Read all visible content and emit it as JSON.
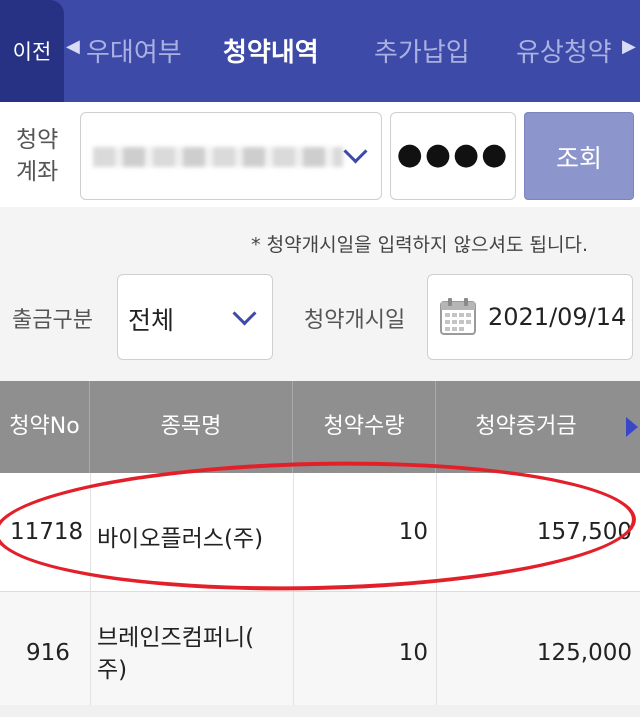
{
  "nav": {
    "back_label": "이전",
    "tabs": [
      {
        "label": "우대여부",
        "active": false
      },
      {
        "label": "청약내역",
        "active": true
      },
      {
        "label": "추가납입",
        "active": false
      },
      {
        "label": "유상청약",
        "active": false
      }
    ],
    "left_arrow": "◀",
    "right_arrow": "▶"
  },
  "account": {
    "label_line1": "청약",
    "label_line2": "계좌",
    "password_mask": "●●●●",
    "query_label": "조회"
  },
  "filters": {
    "notice": "* 청약개시일을 입력하지 않으셔도 됩니다.",
    "type_label": "출금구분",
    "type_value": "전체",
    "date_label": "청약개시일",
    "date_value": "2021/09/14"
  },
  "table": {
    "columns": [
      "청약No",
      "종목명",
      "청약수량",
      "청약증거금"
    ],
    "rows": [
      {
        "no": "11718",
        "name": "바이오플러스(주)",
        "qty": "10",
        "deposit": "157,500"
      },
      {
        "no": "916",
        "name_line1": "브레인즈컴퍼니(",
        "name_line2": "주)",
        "qty": "10",
        "deposit": "125,000"
      }
    ]
  },
  "colors": {
    "nav_bg": "#3d4aa8",
    "back_bg": "#283284",
    "header_bg": "#8f8f8f",
    "highlight": "#e2202a",
    "query_button": "#8c95cc"
  }
}
